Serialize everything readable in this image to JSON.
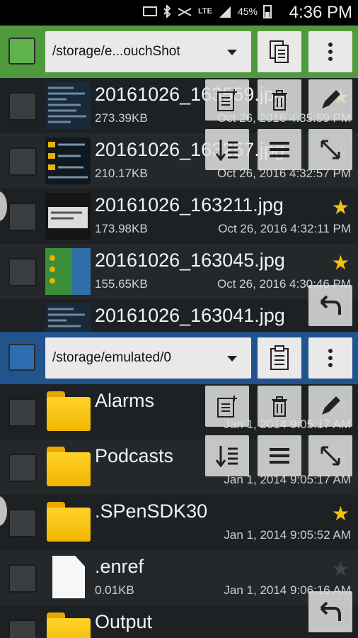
{
  "status": {
    "battery": "45%",
    "network": "LTE",
    "time": "4:36 PM"
  },
  "top_pane": {
    "path": "/storage/e...ouchShot",
    "files": [
      {
        "name": "20161026_163559.jpg",
        "size": "273.39KB",
        "date": "Oct 26, 2016 4:35:59 PM",
        "starred": true
      },
      {
        "name": "20161026_163257.jpg",
        "size": "210.17KB",
        "date": "Oct 26, 2016 4:32:57 PM",
        "starred": false
      },
      {
        "name": "20161026_163211.jpg",
        "size": "173.98KB",
        "date": "Oct 26, 2016 4:32:11 PM",
        "starred": true
      },
      {
        "name": "20161026_163045.jpg",
        "size": "155.65KB",
        "date": "Oct 26, 2016 4:30:46 PM",
        "starred": true
      },
      {
        "name": "20161026_163041.jpg",
        "size": "",
        "date": "",
        "starred": false
      }
    ]
  },
  "bottom_pane": {
    "path": "/storage/emulated/0",
    "files": [
      {
        "name": "Alarms",
        "size": "",
        "date": "Jan 1, 2014 9:05:17 AM",
        "type": "folder",
        "starred": false
      },
      {
        "name": "Podcasts",
        "size": "",
        "date": "Jan 1, 2014 9:05:17 AM",
        "type": "folder",
        "starred": false
      },
      {
        "name": ".SPenSDK30",
        "size": "",
        "date": "Jan 1, 2014 9:05:52 AM",
        "type": "folder",
        "starred": true
      },
      {
        "name": ".enref",
        "size": "0.01KB",
        "date": "Jan 1, 2014 9:06:16 AM",
        "type": "file",
        "starred": false
      },
      {
        "name": "Output",
        "size": "",
        "date": "",
        "type": "folder",
        "starred": false
      }
    ]
  },
  "icons": {
    "star": "★",
    "copy": "copy-icon",
    "paste": "paste-icon",
    "more": "more-vert-icon"
  }
}
